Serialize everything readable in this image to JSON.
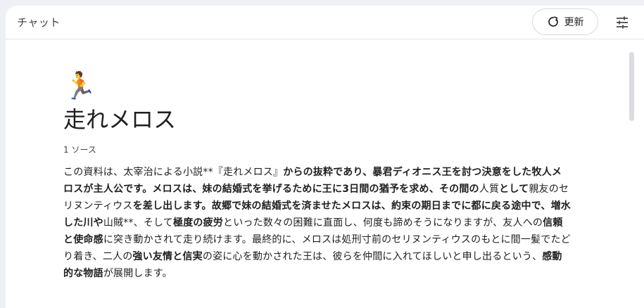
{
  "header": {
    "title": "チャット",
    "refresh_label": "更新",
    "refresh_icon": "refresh-icon",
    "tune_icon": "tune-icon"
  },
  "notebook": {
    "emoji": "🏃",
    "title": "走れメロス",
    "source_count": "1 ソース",
    "summary_segments": [
      {
        "text": "この資料は、太宰治による小説**『走れメロス』",
        "bold": false
      },
      {
        "text": "からの抜粋であり、暴君ディオニス王を討つ決意をした牧人メロスが主人公です。メロスは、妹の結婚式を挙げるために王に3日間の猶予を求め、その間の",
        "bold": true
      },
      {
        "text": "人質",
        "bold": false
      },
      {
        "text": "として",
        "bold": true
      },
      {
        "text": "親友のセリヌンティウス",
        "bold": false
      },
      {
        "text": "を差し出します。故郷で妹の結婚式を済ませたメロスは、約束の期日までに都に戻る途中で、増水した川や",
        "bold": true
      },
      {
        "text": "山賊**、そして",
        "bold": false
      },
      {
        "text": "極度の疲労",
        "bold": true
      },
      {
        "text": "といった数々の困難に直面し、何度も諦めそうになりますが、友人への",
        "bold": false
      },
      {
        "text": "信頼と使命感",
        "bold": true
      },
      {
        "text": "に突き動かされて走り続けます。最終的に、メロスは処刑寸前のセリヌンティウスのもとに間一髪でたどり着き、二人の",
        "bold": false
      },
      {
        "text": "強い友情と信実",
        "bold": true
      },
      {
        "text": "の姿に心を動かされた王は、彼らを仲間に入れてほしいと申し出るという、",
        "bold": false
      },
      {
        "text": "感動的な物語",
        "bold": true
      },
      {
        "text": "が展開します。",
        "bold": false
      }
    ]
  }
}
